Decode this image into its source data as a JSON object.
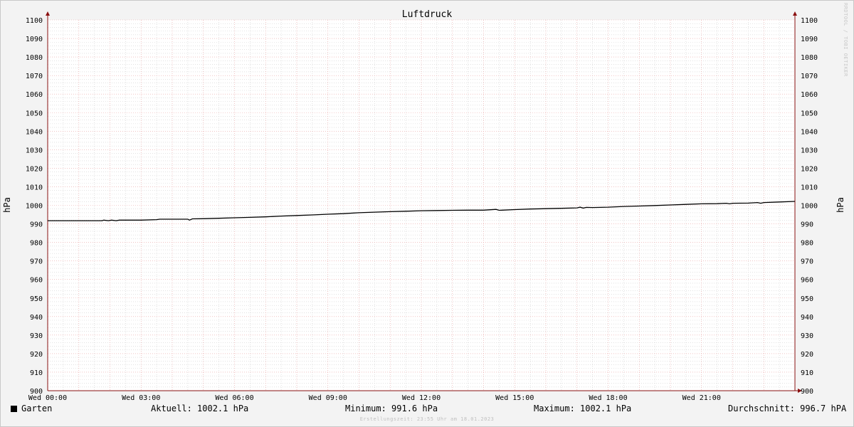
{
  "chart_data": {
    "type": "line",
    "title": "Luftdruck",
    "ylabel_left": "hPa",
    "ylabel_right": "hPa",
    "ylim": [
      900,
      1100
    ],
    "y_ticks": [
      900,
      910,
      920,
      930,
      940,
      950,
      960,
      970,
      980,
      990,
      1000,
      1010,
      1020,
      1030,
      1040,
      1050,
      1060,
      1070,
      1080,
      1090,
      1100
    ],
    "x_range_hours": [
      0,
      24
    ],
    "x_ticks": [
      {
        "hour": 0,
        "label": "Wed 00:00"
      },
      {
        "hour": 3,
        "label": "Wed 03:00"
      },
      {
        "hour": 6,
        "label": "Wed 06:00"
      },
      {
        "hour": 9,
        "label": "Wed 09:00"
      },
      {
        "hour": 12,
        "label": "Wed 12:00"
      },
      {
        "hour": 15,
        "label": "Wed 15:00"
      },
      {
        "hour": 18,
        "label": "Wed 18:00"
      },
      {
        "hour": 21,
        "label": "Wed 21:00"
      }
    ],
    "grid": true,
    "series": [
      {
        "name": "Garten",
        "color": "#000000",
        "x": [
          0,
          1.0,
          1.75,
          1.8,
          1.95,
          2.05,
          2.2,
          2.3,
          2.4,
          3.0,
          3.5,
          3.6,
          4.0,
          4.5,
          4.55,
          4.65,
          5.0,
          5.5,
          6.0,
          6.5,
          7.0,
          7.5,
          8.0,
          8.5,
          9.0,
          9.5,
          10.0,
          10.5,
          11.0,
          11.5,
          12.0,
          12.5,
          13.0,
          13.5,
          14.0,
          14.4,
          14.5,
          14.6,
          15.0,
          15.5,
          16.0,
          16.5,
          17.0,
          17.1,
          17.2,
          17.3,
          17.5,
          18.0,
          18.5,
          19.0,
          19.5,
          20.0,
          20.5,
          21.0,
          21.5,
          21.8,
          21.9,
          22.0,
          22.5,
          22.8,
          22.9,
          23.0,
          23.5,
          24.0
        ],
        "y": [
          991.7,
          991.7,
          991.7,
          992.0,
          991.7,
          992.0,
          991.7,
          992.0,
          992.0,
          992.0,
          992.3,
          992.5,
          992.5,
          992.5,
          992.0,
          992.7,
          992.8,
          993.0,
          993.3,
          993.5,
          993.8,
          994.2,
          994.5,
          994.8,
          995.2,
          995.5,
          996.0,
          996.3,
          996.6,
          996.8,
          997.1,
          997.2,
          997.3,
          997.4,
          997.4,
          997.8,
          997.3,
          997.4,
          997.7,
          998.0,
          998.2,
          998.4,
          998.6,
          999.0,
          998.5,
          998.9,
          998.8,
          999.0,
          999.4,
          999.6,
          999.9,
          1000.2,
          1000.5,
          1000.8,
          1000.9,
          1001.1,
          1000.8,
          1001.1,
          1001.2,
          1001.5,
          1001.1,
          1001.5,
          1001.8,
          1002.1
        ]
      }
    ],
    "legend": {
      "name": "Garten",
      "aktuell": "Aktuell: 1002.1 hPa",
      "minimum": "Minimum: 991.6 hPa",
      "maximum": "Maximum: 1002.1 hPa",
      "durchschnitt": "Durchschnitt: 996.7 hPA"
    },
    "footer": "Erstellungszeit: 23:55 Uhr am 18.01.2023",
    "watermark": "RRDTOOL / TOBI OETIKER"
  },
  "colors": {
    "background": "#f3f3f3",
    "plot": "#ffffff",
    "major_grid": "#e8a0a0",
    "minor_grid": "#d0d0d0",
    "axis": "#8a1010",
    "line": "#000000"
  }
}
